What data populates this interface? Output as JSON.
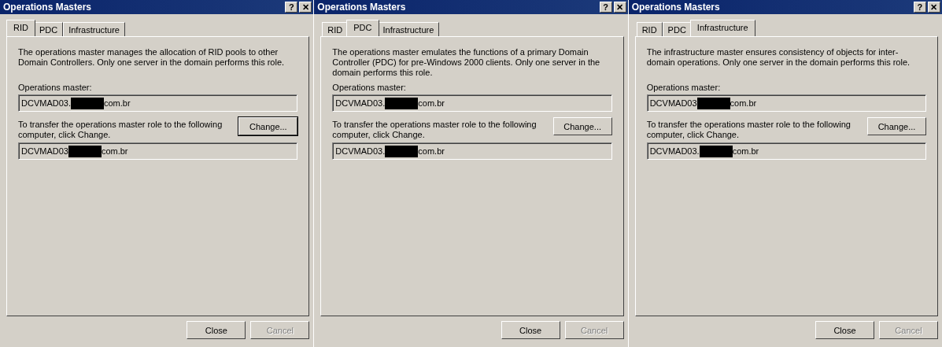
{
  "windows": [
    {
      "title": "Operations Masters",
      "help_button": "?",
      "close_button": "✕",
      "tabs": [
        {
          "label": "RID",
          "selected": true
        },
        {
          "label": "PDC",
          "selected": false
        },
        {
          "label": "Infrastructure",
          "selected": false
        }
      ],
      "description": "The operations master manages the allocation of RID pools to other Domain Controllers. Only one server in the domain performs this role.",
      "master_label": "Operations master:",
      "master_field": {
        "before": "DCVMAD03.",
        "redacted": true,
        "after": "com.br"
      },
      "transfer_text": "To transfer the operations master role to the following computer, click Change.",
      "change_button": {
        "label": "Change...",
        "focused": true
      },
      "target_field": {
        "before": "DCVMAD03",
        "redacted": true,
        "after": "com.br"
      },
      "buttons": [
        {
          "label": "Close",
          "disabled": false
        },
        {
          "label": "Cancel",
          "disabled": true
        }
      ]
    },
    {
      "title": "Operations Masters",
      "help_button": "?",
      "close_button": "✕",
      "tabs": [
        {
          "label": "RID",
          "selected": false
        },
        {
          "label": "PDC",
          "selected": true
        },
        {
          "label": "Infrastructure",
          "selected": false
        }
      ],
      "description": "The operations master emulates the functions of a primary Domain Controller (PDC) for pre-Windows 2000 clients. Only one server in the domain performs this role.",
      "master_label": "Operations master:",
      "master_field": {
        "before": "DCVMAD03.",
        "redacted": true,
        "after": "com.br"
      },
      "transfer_text": "To transfer the operations master role to the following computer, click Change.",
      "change_button": {
        "label": "Change...",
        "focused": false
      },
      "target_field": {
        "before": "DCVMAD03.",
        "redacted": true,
        "after": "com.br"
      },
      "buttons": [
        {
          "label": "Close",
          "disabled": false
        },
        {
          "label": "Cancel",
          "disabled": true
        }
      ]
    },
    {
      "title": "Operations Masters",
      "help_button": "?",
      "close_button": "✕",
      "tabs": [
        {
          "label": "RID",
          "selected": false
        },
        {
          "label": "PDC",
          "selected": false
        },
        {
          "label": "Infrastructure",
          "selected": true
        }
      ],
      "description": "The infrastructure master ensures consistency of objects for inter-domain operations. Only one server in the domain performs this role.",
      "master_label": "Operations master:",
      "master_field": {
        "before": "DCVMAD03",
        "redacted": true,
        "after": "com.br"
      },
      "transfer_text": "To transfer the operations master role to the following computer, click Change.",
      "change_button": {
        "label": "Change...",
        "focused": false
      },
      "target_field": {
        "before": "DCVMAD03.",
        "redacted": true,
        "after": "com.br"
      },
      "buttons": [
        {
          "label": "Close",
          "disabled": false
        },
        {
          "label": "Cancel",
          "disabled": true
        }
      ]
    }
  ]
}
